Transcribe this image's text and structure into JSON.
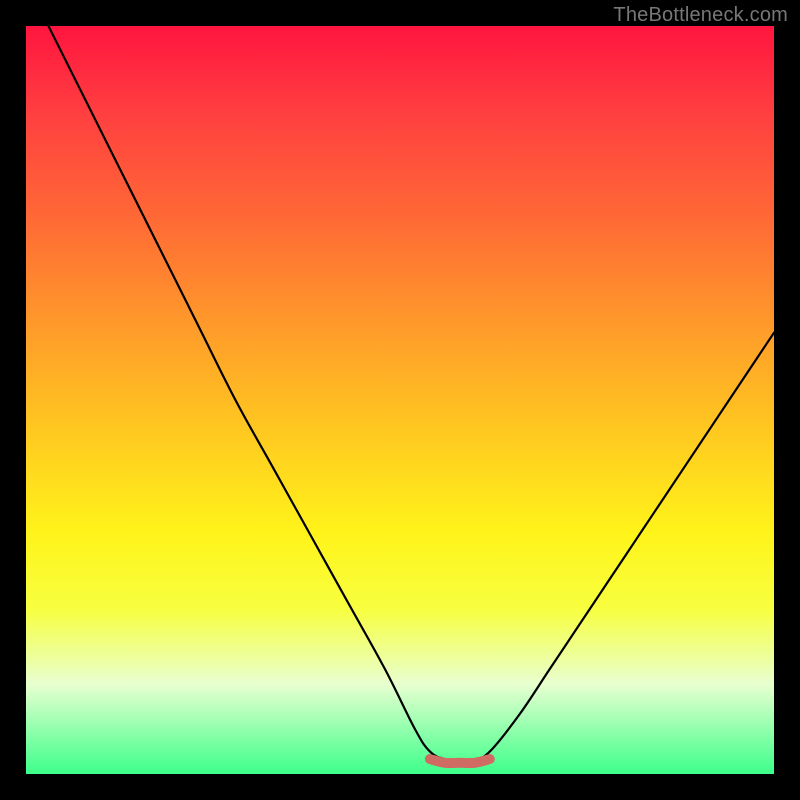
{
  "watermark": "TheBottleneck.com",
  "chart_data": {
    "type": "line",
    "title": "",
    "xlabel": "",
    "ylabel": "",
    "xlim": [
      0,
      100
    ],
    "ylim": [
      0,
      100
    ],
    "series": [
      {
        "name": "bottleneck-curve",
        "x": [
          3,
          8,
          13,
          18,
          23,
          28,
          33,
          38,
          43,
          48,
          52,
          54,
          56,
          58,
          60,
          62,
          66,
          70,
          74,
          78,
          82,
          86,
          90,
          94,
          98,
          100
        ],
        "values": [
          100,
          90,
          80,
          70,
          60,
          50,
          41,
          32,
          23,
          14,
          6,
          3,
          2,
          2,
          2,
          3,
          8,
          14,
          20,
          26,
          32,
          38,
          44,
          50,
          56,
          59
        ]
      },
      {
        "name": "flat-highlight",
        "x": [
          54,
          56,
          58,
          60,
          62
        ],
        "values": [
          2,
          1.5,
          1.5,
          1.5,
          2
        ]
      }
    ],
    "colors": {
      "curve": "#000000",
      "highlight": "#cf6b63"
    }
  }
}
